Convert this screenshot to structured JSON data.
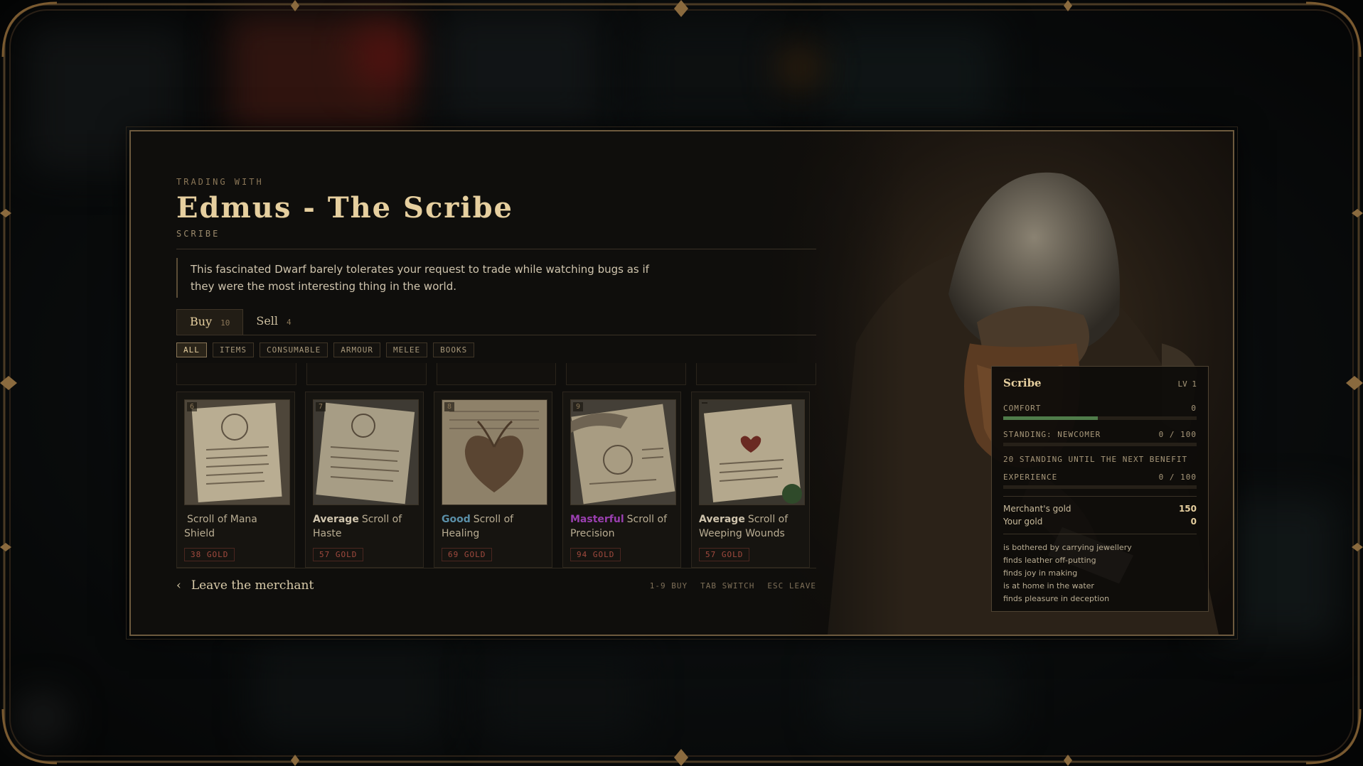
{
  "header": {
    "eyebrow": "TRADING WITH",
    "title": "Edmus - The Scribe",
    "subtitle": "SCRIBE",
    "description": "This fascinated Dwarf barely tolerates your request to trade while watching bugs as if they were the most interesting thing in the world."
  },
  "tabs": [
    {
      "label": "Buy",
      "count": "10"
    },
    {
      "label": "Sell",
      "count": "4"
    }
  ],
  "filters": [
    "ALL",
    "ITEMS",
    "CONSUMABLE",
    "ARMOUR",
    "MELEE",
    "BOOKS"
  ],
  "items": [
    {
      "slot": "6",
      "quality": "",
      "quality_color": "#b9ad93",
      "name": "Scroll of Mana Shield",
      "price": "38 GOLD"
    },
    {
      "slot": "7",
      "quality": "Average",
      "quality_color": "#cfc4ad",
      "name": "Scroll of Haste",
      "price": "57 GOLD"
    },
    {
      "slot": "8",
      "quality": "Good",
      "quality_color": "#5a8fa8",
      "name": "Scroll of Healing",
      "price": "69 GOLD"
    },
    {
      "slot": "9",
      "quality": "Masterful",
      "quality_color": "#9a3fb0",
      "name": "Scroll of Precision",
      "price": "94 GOLD"
    },
    {
      "slot": "",
      "quality": "Average",
      "quality_color": "#cfc4ad",
      "name": "Scroll of Weeping Wounds",
      "price": "57 GOLD"
    }
  ],
  "footer": {
    "leave_label": "Leave the merchant",
    "hint_buy": "1-9 BUY",
    "hint_switch": "TAB SWITCH",
    "hint_leave": "ESC LEAVE"
  },
  "stats": {
    "name": "Scribe",
    "level": "LV 1",
    "comfort_label": "COMFORT",
    "comfort_value": "0",
    "comfort_fill": 0.49,
    "standing_label": "STANDING: NEWCOMER",
    "standing_value": "0 / 100",
    "standing_fill": 0,
    "standing_note": "20 STANDING UNTIL THE NEXT BENEFIT",
    "experience_label": "EXPERIENCE",
    "experience_value": "0 / 100",
    "experience_fill": 0,
    "merchant_gold_label": "Merchant's gold",
    "merchant_gold": "150",
    "your_gold_label": "Your gold",
    "your_gold": "0",
    "traits": [
      "is bothered by carrying jewellery",
      "finds leather off-putting",
      "finds joy in making",
      "is at home in the water",
      "finds pleasure in deception"
    ]
  },
  "colors": {
    "accent": "#e6cf9f",
    "price": "#a14a3e",
    "comfort_bar": "#4f7c4a"
  }
}
